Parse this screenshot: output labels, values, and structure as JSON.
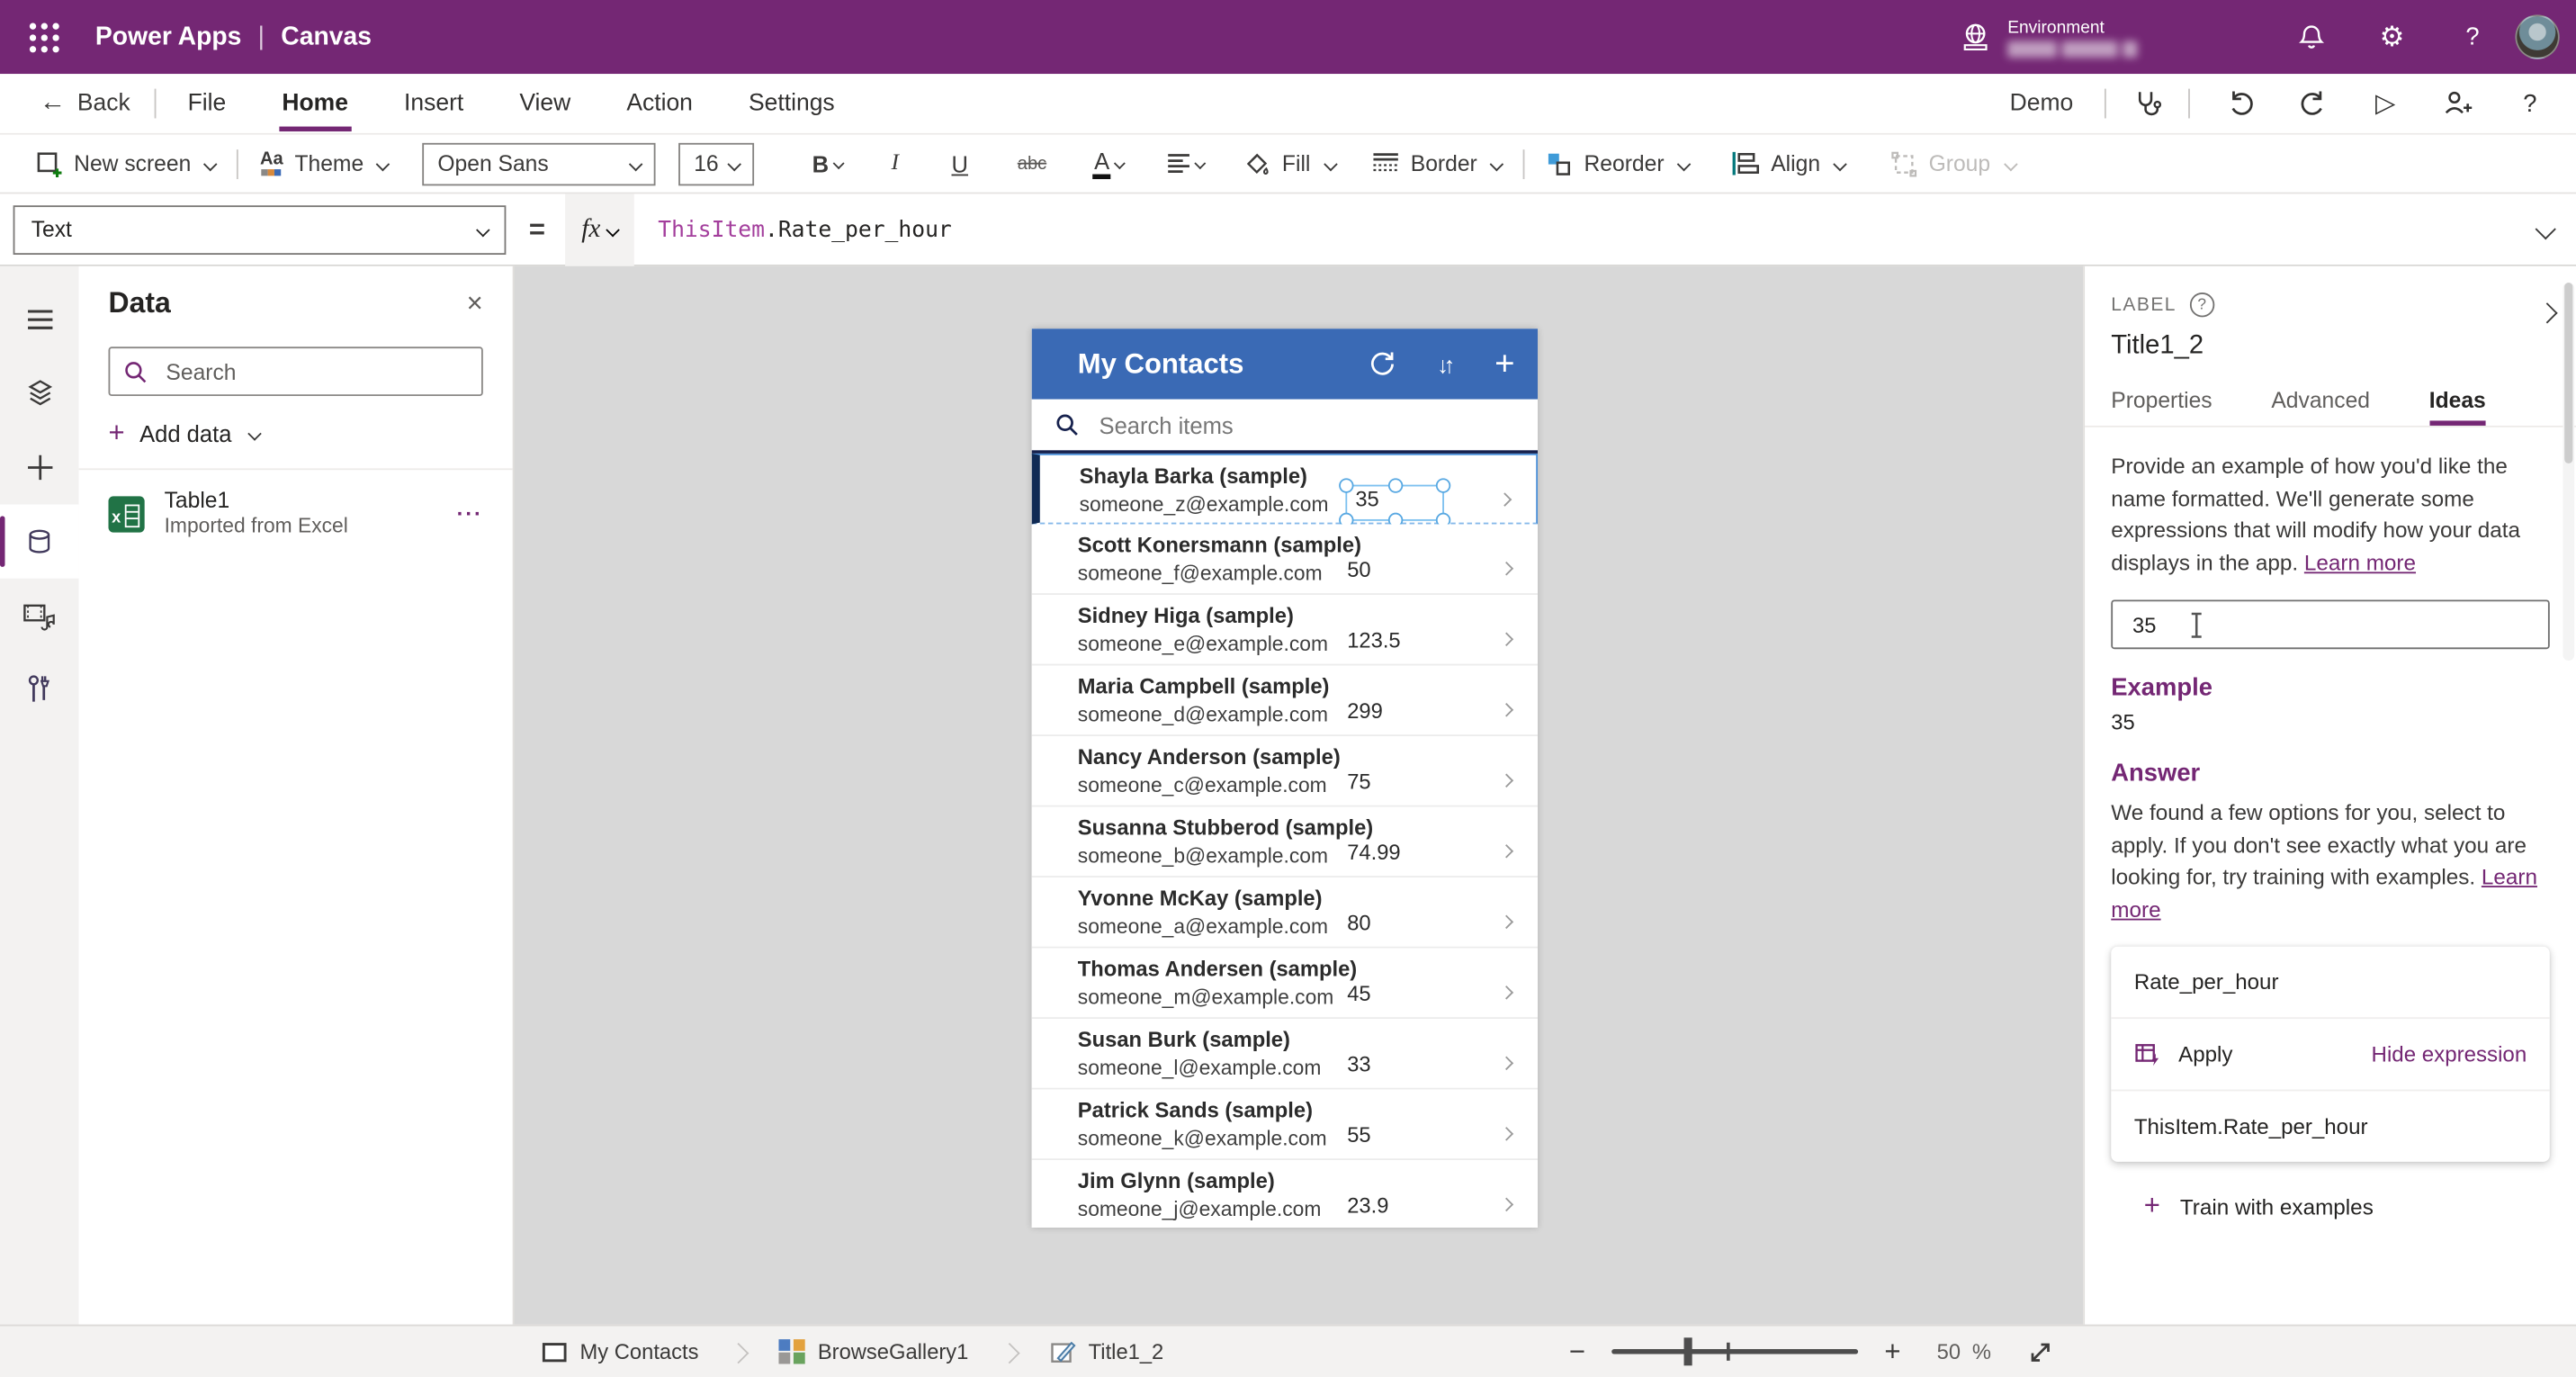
{
  "colors": {
    "brand_purple": "#742774",
    "gallery_header_blue": "#3a6ab5",
    "selection_blue": "#58a8e2",
    "selected_bar_navy": "#102a54",
    "excel_green": "#217346",
    "canvas_gray": "#d8d8d8",
    "formula_keyword": "#a33e9c"
  },
  "topbar": {
    "app_name": "Power Apps",
    "separator": "|",
    "mode": "Canvas",
    "environment_label": "Environment"
  },
  "menubar": {
    "back_label": "Back",
    "items": [
      "File",
      "Home",
      "Insert",
      "View",
      "Action",
      "Settings"
    ],
    "active_item": "Home",
    "app_env_name": "Demo"
  },
  "toolbar": {
    "new_screen_label": "New screen",
    "theme_label": "Theme",
    "theme_icon_text": "Aa",
    "font_name": "Open Sans",
    "font_size": "16",
    "bold_label": "B",
    "italic_label": "I",
    "underline_label": "U",
    "strikethrough_label": "abc",
    "font_color_label": "A",
    "fill_label": "Fill",
    "border_label": "Border",
    "reorder_label": "Reorder",
    "align_label": "Align",
    "group_label": "Group"
  },
  "formula_bar": {
    "property_selected": "Text",
    "equals": "=",
    "fx_label": "fx",
    "expression_keyword": "ThisItem",
    "expression_rest": ".Rate_per_hour"
  },
  "data_panel": {
    "title": "Data",
    "close_label": "×",
    "search_placeholder": "Search",
    "add_data_label": "Add data",
    "table_name": "Table1",
    "table_subtitle": "Imported from Excel",
    "more_label": "···"
  },
  "gallery": {
    "title": "My Contacts",
    "search_placeholder": "Search items",
    "rows": [
      {
        "name": "Shayla Barka (sample)",
        "email": "someone_z@example.com",
        "rate": "35"
      },
      {
        "name": "Scott Konersmann (sample)",
        "email": "someone_f@example.com",
        "rate": "50"
      },
      {
        "name": "Sidney Higa (sample)",
        "email": "someone_e@example.com",
        "rate": "123.5"
      },
      {
        "name": "Maria Campbell (sample)",
        "email": "someone_d@example.com",
        "rate": "299"
      },
      {
        "name": "Nancy Anderson (sample)",
        "email": "someone_c@example.com",
        "rate": "75"
      },
      {
        "name": "Susanna Stubberod (sample)",
        "email": "someone_b@example.com",
        "rate": "74.99"
      },
      {
        "name": "Yvonne McKay (sample)",
        "email": "someone_a@example.com",
        "rate": "80"
      },
      {
        "name": "Thomas Andersen (sample)",
        "email": "someone_m@example.com",
        "rate": "45"
      },
      {
        "name": "Susan Burk (sample)",
        "email": "someone_l@example.com",
        "rate": "33"
      },
      {
        "name": "Patrick Sands (sample)",
        "email": "someone_k@example.com",
        "rate": "55"
      },
      {
        "name": "Jim Glynn (sample)",
        "email": "someone_j@example.com",
        "rate": "23.9"
      }
    ]
  },
  "right_panel": {
    "control_type_label": "LABEL",
    "control_name": "Title1_2",
    "tabs": [
      "Properties",
      "Advanced",
      "Ideas"
    ],
    "active_tab": "Ideas",
    "intro_text": "Provide an example of how you'd like the name formatted. We'll generate some expressions that will modify how your data displays in the app. ",
    "intro_link": "Learn more",
    "example_input_value": "35",
    "example_heading": "Example",
    "example_value": "35",
    "answer_heading": "Answer",
    "answer_text": "We found a few options for you, select to apply. If you don't see exactly what you are looking for, try training with examples. ",
    "answer_link": "Learn more",
    "suggestion_name": "Rate_per_hour",
    "apply_label": "Apply",
    "hide_expression_label": "Hide expression",
    "expression_value": "ThisItem.Rate_per_hour",
    "train_label": "Train with examples"
  },
  "bottom_bar": {
    "breadcrumbs": [
      {
        "label": "My Contacts"
      },
      {
        "label": "BrowseGallery1"
      },
      {
        "label": "Title1_2"
      }
    ],
    "zoom_value": "50",
    "zoom_percent": "%"
  }
}
